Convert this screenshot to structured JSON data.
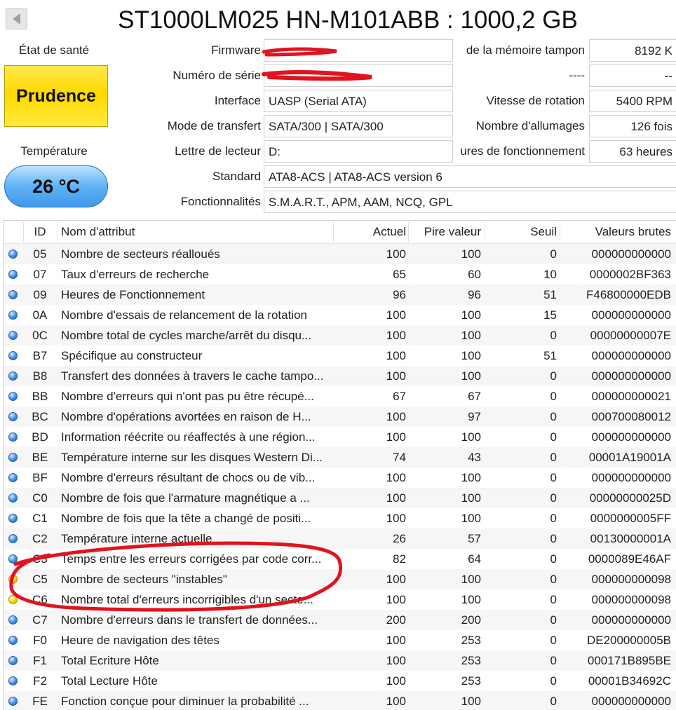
{
  "header": {
    "back_label": "",
    "title": "ST1000LM025 HN-M101ABB : 1000,2 GB"
  },
  "health": {
    "label": "État de santé",
    "status": "Prudence",
    "status_color": "#ffd800"
  },
  "temperature": {
    "label": "Température",
    "value": "26 °C",
    "badge_color": "#4fa5ef"
  },
  "info": {
    "firmware": {
      "label": "Firmware",
      "value": ""
    },
    "serial": {
      "label": "Numéro de série",
      "value": ""
    },
    "interface": {
      "label": "Interface",
      "value": "UASP (Serial ATA)"
    },
    "transfer_mode": {
      "label": "Mode de transfert",
      "value": "SATA/300 | SATA/300"
    },
    "drive_letter": {
      "label": "Lettre de lecteur",
      "value": "D:"
    },
    "standard": {
      "label": "Standard",
      "value": "ATA8-ACS | ATA8-ACS version 6"
    },
    "features": {
      "label": "Fonctionnalités",
      "value": "S.M.A.R.T., APM, AAM, NCQ, GPL"
    }
  },
  "right_info": {
    "buffer": {
      "label": "de la mémoire tampon",
      "value": "8192 K"
    },
    "unknown": {
      "label": "----",
      "value": "--"
    },
    "rotation": {
      "label": "Vitesse de rotation",
      "value": "5400 RPM"
    },
    "power_on_count": {
      "label": "Nombre d'allumages",
      "value": "126 fois"
    },
    "power_on_hours": {
      "label": "ures de fonctionnement",
      "value": "63 heures"
    }
  },
  "table": {
    "headers": {
      "id": "ID",
      "name": "Nom d'attribut",
      "current": "Actuel",
      "worst": "Pire valeur",
      "threshold": "Seuil",
      "raw": "Valeurs brutes"
    },
    "rows": [
      {
        "status": "good",
        "id": "05",
        "name": "Nombre de secteurs réalloués",
        "current": "100",
        "worst": "100",
        "threshold": "0",
        "raw": "000000000000"
      },
      {
        "status": "good",
        "id": "07",
        "name": "Taux d'erreurs de recherche",
        "current": "65",
        "worst": "60",
        "threshold": "10",
        "raw": "0000002BF363"
      },
      {
        "status": "good",
        "id": "09",
        "name": "Heures de Fonctionnement",
        "current": "96",
        "worst": "96",
        "threshold": "51",
        "raw": "F46800000EDB"
      },
      {
        "status": "good",
        "id": "0A",
        "name": "Nombre d'essais de relancement de la rotation",
        "current": "100",
        "worst": "100",
        "threshold": "15",
        "raw": "000000000000"
      },
      {
        "status": "good",
        "id": "0C",
        "name": "Nombre total de cycles marche/arrêt du disqu...",
        "current": "100",
        "worst": "100",
        "threshold": "0",
        "raw": "00000000007E"
      },
      {
        "status": "good",
        "id": "B7",
        "name": "Spécifique au constructeur",
        "current": "100",
        "worst": "100",
        "threshold": "51",
        "raw": "000000000000"
      },
      {
        "status": "good",
        "id": "B8",
        "name": "Transfert des données à travers le cache tampo...",
        "current": "100",
        "worst": "100",
        "threshold": "0",
        "raw": "000000000000"
      },
      {
        "status": "good",
        "id": "BB",
        "name": "Nombre d'erreurs qui n'ont pas pu être récupé...",
        "current": "67",
        "worst": "67",
        "threshold": "0",
        "raw": "000000000021"
      },
      {
        "status": "good",
        "id": "BC",
        "name": "Nombre d'opérations avortées en raison de H...",
        "current": "100",
        "worst": "97",
        "threshold": "0",
        "raw": "000700080012"
      },
      {
        "status": "good",
        "id": "BD",
        "name": "Information réécrite ou réaffectés à une région...",
        "current": "100",
        "worst": "100",
        "threshold": "0",
        "raw": "000000000000"
      },
      {
        "status": "good",
        "id": "BE",
        "name": "Température interne sur les disques Western Di...",
        "current": "74",
        "worst": "43",
        "threshold": "0",
        "raw": "00001A19001A"
      },
      {
        "status": "good",
        "id": "BF",
        "name": "Nombre d'erreurs résultant de chocs ou de vib...",
        "current": "100",
        "worst": "100",
        "threshold": "0",
        "raw": "000000000000"
      },
      {
        "status": "good",
        "id": "C0",
        "name": "Nombre de fois que l'armature magnétique a ...",
        "current": "100",
        "worst": "100",
        "threshold": "0",
        "raw": "00000000025D"
      },
      {
        "status": "good",
        "id": "C1",
        "name": "Nombre de fois que la tête a changé de positi...",
        "current": "100",
        "worst": "100",
        "threshold": "0",
        "raw": "0000000005FF"
      },
      {
        "status": "good",
        "id": "C2",
        "name": "Température interne actuelle",
        "current": "26",
        "worst": "57",
        "threshold": "0",
        "raw": "00130000001A"
      },
      {
        "status": "good",
        "id": "C3",
        "name": "Temps entre les erreurs corrigées par code corr...",
        "current": "82",
        "worst": "64",
        "threshold": "0",
        "raw": "0000089E46AF"
      },
      {
        "status": "caution",
        "id": "C5",
        "name": "Nombre de secteurs \"instables\"",
        "current": "100",
        "worst": "100",
        "threshold": "0",
        "raw": "000000000098"
      },
      {
        "status": "caution",
        "id": "C6",
        "name": "Nombre total d'erreurs incorrigibles d'un secte...",
        "current": "100",
        "worst": "100",
        "threshold": "0",
        "raw": "000000000098"
      },
      {
        "status": "good",
        "id": "C7",
        "name": "Nombre d'erreurs dans le transfert de données...",
        "current": "200",
        "worst": "200",
        "threshold": "0",
        "raw": "000000000000"
      },
      {
        "status": "good",
        "id": "F0",
        "name": "Heure de navigation des têtes",
        "current": "100",
        "worst": "253",
        "threshold": "0",
        "raw": "DE200000005B"
      },
      {
        "status": "good",
        "id": "F1",
        "name": "Total Ecriture Hôte",
        "current": "100",
        "worst": "253",
        "threshold": "0",
        "raw": "000171B895BE"
      },
      {
        "status": "good",
        "id": "F2",
        "name": "Total Lecture Hôte",
        "current": "100",
        "worst": "253",
        "threshold": "0",
        "raw": "00001B34692C"
      },
      {
        "status": "good",
        "id": "FE",
        "name": "Fonction conçue pour diminuer la probabilité ...",
        "current": "100",
        "worst": "100",
        "threshold": "0",
        "raw": "000000000000"
      }
    ]
  },
  "annotations": {
    "redaction_color": "#e0141e",
    "circle_color": "#e0141e"
  }
}
